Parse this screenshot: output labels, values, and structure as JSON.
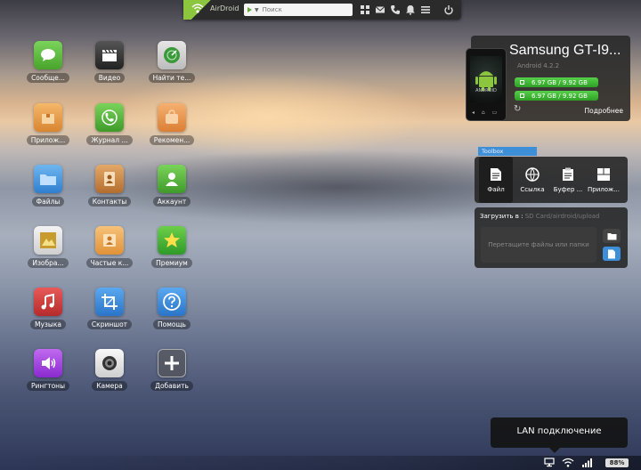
{
  "topbar": {
    "brand": "AirDroid",
    "search_placeholder": "Поиск",
    "icons": [
      "apps-grid-icon",
      "mail-icon",
      "phone-icon",
      "notification-bell-icon",
      "menu-icon",
      "power-icon"
    ]
  },
  "apps": [
    {
      "label": "Сообще...",
      "icon": "messages-icon",
      "color": "#5bbf3a"
    },
    {
      "label": "Видео",
      "icon": "video-clapper-icon",
      "color": "#3a3a3a"
    },
    {
      "label": "Найти те...",
      "icon": "find-phone-icon",
      "color": "#2f8f3a"
    },
    {
      "label": "Прилож...",
      "icon": "apps-box-icon",
      "color": "#e8953a"
    },
    {
      "label": "Журнал ...",
      "icon": "call-log-icon",
      "color": "#4fb83a"
    },
    {
      "label": "Рекомен...",
      "icon": "recommend-icon",
      "color": "#e89a3a"
    },
    {
      "label": "Файлы",
      "icon": "folder-icon",
      "color": "#3a8fd8"
    },
    {
      "label": "Контакты",
      "icon": "contacts-icon",
      "color": "#c88640"
    },
    {
      "label": "Аккаунт",
      "icon": "account-icon",
      "color": "#4fb83a"
    },
    {
      "label": "Изобра...",
      "icon": "photos-icon",
      "color": "#c9a03a"
    },
    {
      "label": "Частые к...",
      "icon": "frequent-contacts-icon",
      "color": "#e8a53a"
    },
    {
      "label": "Премиум",
      "icon": "star-icon",
      "color": "#3aaa3a"
    },
    {
      "label": "Музыка",
      "icon": "music-icon",
      "color": "#d83a3a"
    },
    {
      "label": "Скриншот",
      "icon": "crop-icon",
      "color": "#3a8fd8"
    },
    {
      "label": "Помощь",
      "icon": "help-icon",
      "color": "#3a8fd8"
    },
    {
      "label": "Рингтоны",
      "icon": "ringtone-icon",
      "color": "#9a3ad8"
    },
    {
      "label": "Камера",
      "icon": "camera-icon",
      "color": "#e8e8e8"
    },
    {
      "label": "Добавить",
      "icon": "add-icon",
      "color": "#555"
    }
  ],
  "device": {
    "name": "Samsung GT-I9...",
    "os": "Android 4.2.2",
    "phone_brand": "ANDROID",
    "storage_1": "6.97 GB / 9.92 GB",
    "storage_2": "6.97 GB / 9.92 GB",
    "details": "Подробнее"
  },
  "toolbox": {
    "tab": "Toolbox",
    "tools": [
      {
        "label": "Файл",
        "icon": "file-icon"
      },
      {
        "label": "Ссылка",
        "icon": "globe-link-icon"
      },
      {
        "label": "Буфер ...",
        "icon": "clipboard-icon"
      },
      {
        "label": "Прилож...",
        "icon": "app-install-icon"
      }
    ]
  },
  "upload": {
    "title": "Загрузить в :",
    "path": "SD Card/airdroid/upload",
    "drop_text": "Перетащите файлы или папки"
  },
  "lan": {
    "text": "LAN подключение"
  },
  "status": {
    "battery": "88%",
    "accent": "#3d8fd8"
  }
}
